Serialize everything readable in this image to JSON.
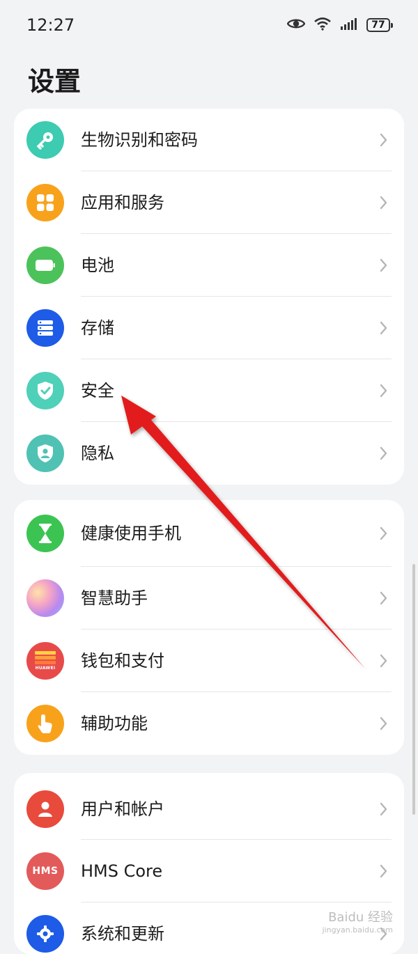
{
  "status_bar": {
    "time": "12:27",
    "battery": "77",
    "icons": [
      "eye-icon",
      "wifi-icon",
      "signal-icon",
      "battery-icon"
    ]
  },
  "header": {
    "title": "设置"
  },
  "groups": [
    {
      "items": [
        {
          "label": "生物识别和密码",
          "icon": "key-icon",
          "color": "#3dcbb1"
        },
        {
          "label": "应用和服务",
          "icon": "apps-grid-icon",
          "color": "#f8a21b"
        },
        {
          "label": "电池",
          "icon": "battery-icon",
          "color": "#4cc25b"
        },
        {
          "label": "存储",
          "icon": "storage-icon",
          "color": "#1e5be6"
        },
        {
          "label": "安全",
          "icon": "shield-check-icon",
          "color": "#4fd0b9"
        },
        {
          "label": "隐私",
          "icon": "privacy-shield-icon",
          "color": "#4fc2b4"
        }
      ]
    },
    {
      "items": [
        {
          "label": "健康使用手机",
          "icon": "hourglass-icon",
          "color": "#3cc452"
        },
        {
          "label": "智慧助手",
          "icon": "assistant-orb-icon",
          "color": "#c493e8"
        },
        {
          "label": "钱包和支付",
          "icon": "wallet-icon",
          "color": "#e84a4a",
          "icon_text": "HUAWEI"
        },
        {
          "label": "辅助功能",
          "icon": "hand-pointer-icon",
          "color": "#f8a21b"
        }
      ]
    },
    {
      "items": [
        {
          "label": "用户和帐户",
          "icon": "user-icon",
          "color": "#e84a3c"
        },
        {
          "label": "HMS Core",
          "icon": "hms-icon",
          "color": "#e35a5a",
          "icon_text": "HMS"
        },
        {
          "label": "系统和更新",
          "icon": "system-gear-icon",
          "color": "#1e5be6"
        }
      ]
    }
  ],
  "watermark": {
    "text": "Baidu 经验",
    "subtext": "jingyan.baidu.com"
  }
}
